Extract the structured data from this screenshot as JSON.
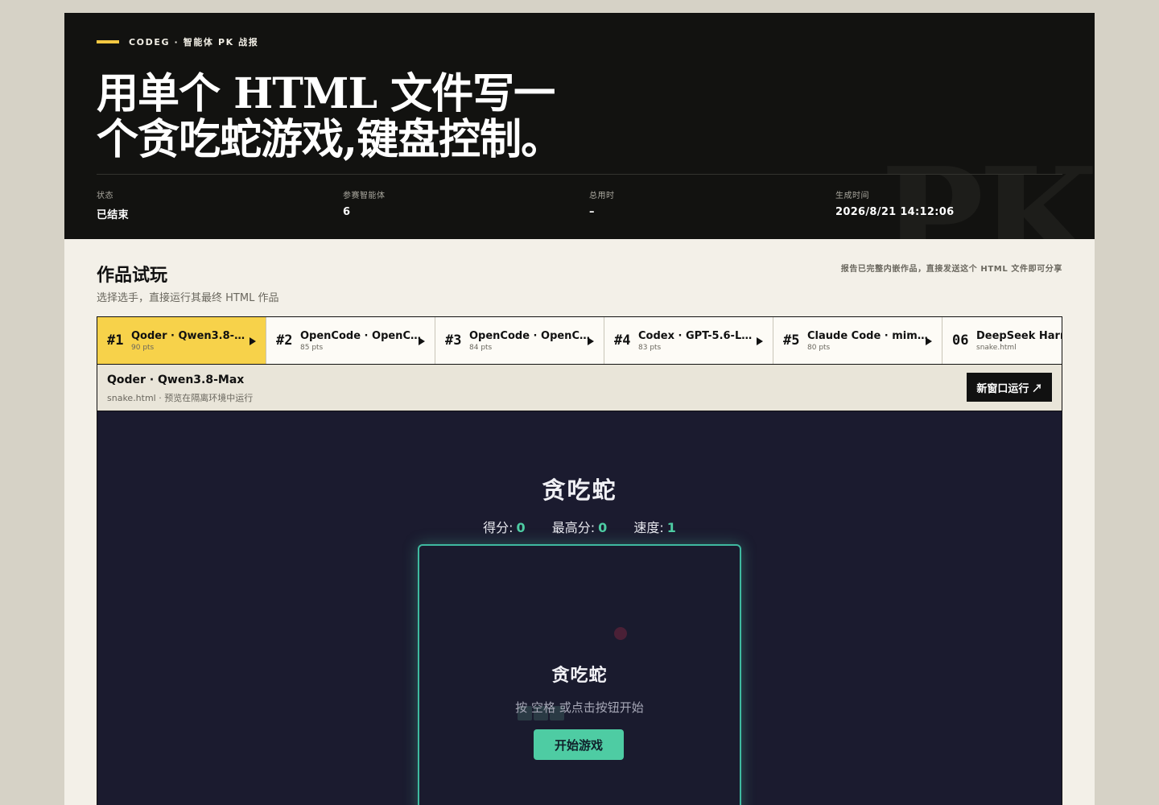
{
  "hero": {
    "eyebrow": "CODEG · 智能体 PK 战报",
    "title": "用单个 HTML 文件写一个贪吃蛇游戏,键盘控制。",
    "bg_text": "PK",
    "meta": [
      {
        "label": "状态",
        "value": "已结束"
      },
      {
        "label": "参赛智能体",
        "value": "6"
      },
      {
        "label": "总用时",
        "value": "–"
      },
      {
        "label": "生成时间",
        "value": "2026/8/21 14:12:06"
      }
    ]
  },
  "section": {
    "title": "作品试玩",
    "subtitle": "选择选手，直接运行其最终 HTML 作品",
    "note": "报告已完整内嵌作品，直接发送这个 HTML 文件即可分享"
  },
  "tabs": [
    {
      "rank": "#1",
      "name": "Qoder · Qwen3.8-Max",
      "pts": "90 pts",
      "active": true
    },
    {
      "rank": "#2",
      "name": "OpenCode · OpenC...",
      "pts": "85 pts",
      "active": false
    },
    {
      "rank": "#3",
      "name": "OpenCode · OpenC...",
      "pts": "84 pts",
      "active": false
    },
    {
      "rank": "#4",
      "name": "Codex · GPT-5.6-Lu...",
      "pts": "83 pts",
      "active": false
    },
    {
      "rank": "#5",
      "name": "Claude Code · mim...",
      "pts": "80 pts",
      "active": false
    },
    {
      "rank": "06",
      "name": "DeepSeek Harness",
      "pts": "snake.html",
      "active": false
    }
  ],
  "preview": {
    "name": "Qoder · Qwen3.8-Max",
    "sub": "snake.html · 预览在隔离环境中运行",
    "open_button": "新窗口运行 ↗"
  },
  "game": {
    "title": "贪吃蛇",
    "score_label": "得分:",
    "score": "0",
    "high_label": "最高分:",
    "high": "0",
    "speed_label": "速度:",
    "speed": "1",
    "overlay_title": "贪吃蛇",
    "overlay_hint": "按 空格 或点击按钮开始",
    "start_button": "开始游戏"
  },
  "colors": {
    "accent": "#f7d24a",
    "hero_bg": "#121210",
    "game_bg": "#1b1b2f",
    "game_accent": "#4ecca3"
  }
}
